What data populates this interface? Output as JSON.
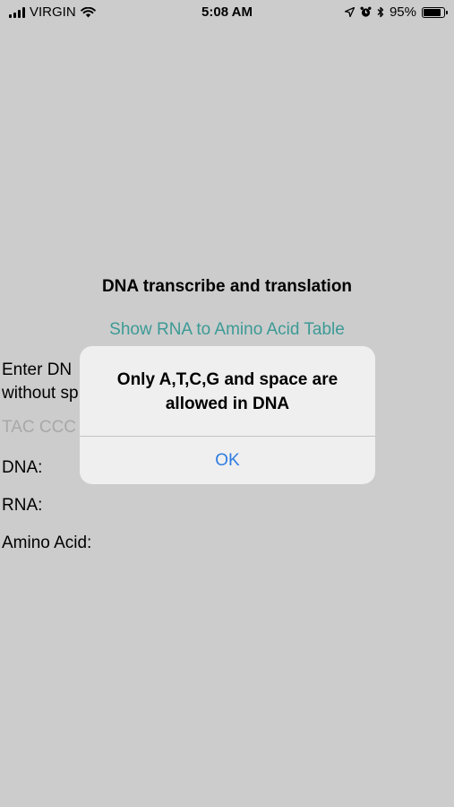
{
  "status_bar": {
    "carrier": "VIRGIN",
    "time": "5:08 AM",
    "battery_percent": "95%",
    "battery_level": 0.95
  },
  "main": {
    "title": "DNA transcribe and translation",
    "table_link": "Show RNA to Amino Acid Table",
    "instructions_line1": "Enter DN",
    "instructions_line2": "without sp",
    "input_placeholder": "TAC CCC",
    "dna_label": "DNA:",
    "rna_label": "RNA:",
    "amino_label": "Amino Acid:"
  },
  "alert": {
    "message_line1": "Only A,T,C,G and space are",
    "message_line2": "allowed in DNA",
    "ok_label": "OK"
  },
  "colors": {
    "background": "#cccccc",
    "link": "#3c9a96",
    "alert_button": "#2f7de1"
  }
}
